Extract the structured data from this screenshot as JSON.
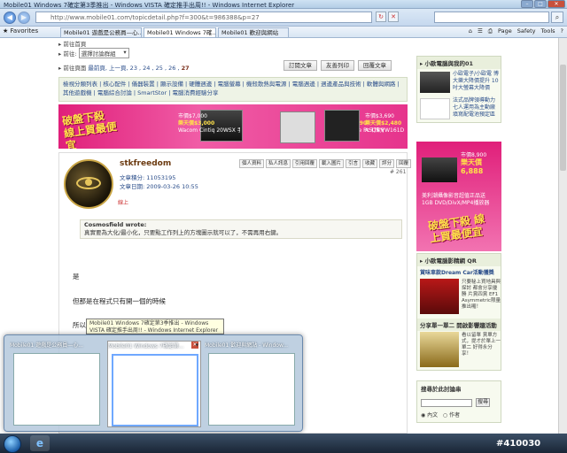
{
  "window": {
    "title": "Mobile01 Windows 7確定第3季推出 - Windows VISTA 確定推手出周!! - Windows Internet Explorer"
  },
  "address": {
    "url": "http://www.mobile01.com/topicdetail.php?f=300&t=986388&p=27"
  },
  "tabs": [
    {
      "label": "Mobile01 遊戲是公務員—心..."
    },
    {
      "label": "Mobile01 Windows 7確..."
    },
    {
      "label": "Mobile01 歡迎與網站"
    }
  ],
  "toolbar": {
    "favorites": "Favorites",
    "page": "Page",
    "safety": "Safety",
    "tools": "Tools"
  },
  "breadcrumb": {
    "line1": "▸ 前往首頁",
    "goto_label": "▸ 前往:",
    "goto_select": "選擇討論群組",
    "pages_prefix": "▸ 前往頁面",
    "pages": "最前頁, 上一頁, 23 , 24 , 25 , 26 ,",
    "current_page": "27"
  },
  "actions": {
    "subscribe": "訂閱文章",
    "print": "友善列印",
    "reply": "回覆文章"
  },
  "categories": "檢視分類列表 | 核心配件 | 儀器裝置 | 顯示設備 | 硬體週邊 | 電腦螢幕 | 機殼散熱與電源 | 電腦週邊 | 週邊產品與技術 | 軟體與網路 | 其他遊戲機 | 電腦綜合討論 | SmartStor | 電腦消費經驗分享",
  "banner": {
    "slogan": "破盤下殺 線上買最便宜",
    "items": [
      {
        "orig": "市價$7,000",
        "price": "樂天價$3,000",
        "name": "Wacom Cintiq 20WSX 手寫液晶顯示器"
      },
      {
        "orig": "市價$3,690",
        "price": "樂天價$3,290",
        "name": "中華台灣Eee Pc 行動影音隨身碟"
      },
      {
        "orig": "市價$3,690",
        "price": "樂天價$2,480",
        "name": "ASUS VW161D 16吋寬螢幕"
      }
    ]
  },
  "post": {
    "username": "stkfreedom",
    "posts": "文章積分: 11053195",
    "date": "文章日期: 2009-03-26 10:55",
    "online": "線上",
    "buttons": [
      "個人資料",
      "私人訊息",
      "引用回覆",
      "載入圖片",
      "引言",
      "收藏",
      "評分",
      "回覆"
    ],
    "floor": "# 261",
    "quote_author": "Cosmosfield wrote:",
    "quote_text": "真實要為大化/最小化，只要點工作列上的方塊圖示就可以了，不需再用右鍵。",
    "line1": "是",
    "line2": "但那是在程式只有開一個的時候",
    "line3": "所以"
  },
  "tooltip": "Mobile01 Windows 7確定第3季推出 - Windows VISTA 確定推手出周!! - Windows Internet Explorer",
  "sidebar": {
    "heading1": "▸ 小歐電腦與我的01",
    "items": [
      {
        "text": "小歐電子/小歐電 博大樂大降價提升 10吋大螢幕大降價"
      },
      {
        "text": "法式品牌領導動力 七人運用為主動廠 填寫配電池預定區"
      }
    ],
    "rakuten_price": "樂天價6,888",
    "rakuten_orig": "市價8,900",
    "rakuten_name": "美利潮攝像影音超值正品送1GB DVD/DivX/MP4播放器",
    "heading2": "▸ 小歐電腦影精網 QR",
    "article_title": "賞味車款Dream Car活動獲獎",
    "article_text": "只要秘上買地具與探討 都會分享優勝 片賞四賞 EF1 Asymmetric限量推出囉！",
    "heading3": "分享單一單二 開啟影響趨活動",
    "article2_text": "看以留單 賞單方式，提才於單上一單二 好得永分享！",
    "search_title": "搜尋於此討論串",
    "search_go": "搜尋",
    "radio_content": "內文",
    "radio_author": "作者"
  },
  "taskbar": {
    "thumbs": [
      {
        "label": "Mobile01 遊戲是公務員—心..."
      },
      {
        "label": "Mobile01 Windows 7確定第..."
      },
      {
        "label": "Mobile01 歡迎與網站 - Window..."
      }
    ],
    "watermark": "#410030"
  }
}
